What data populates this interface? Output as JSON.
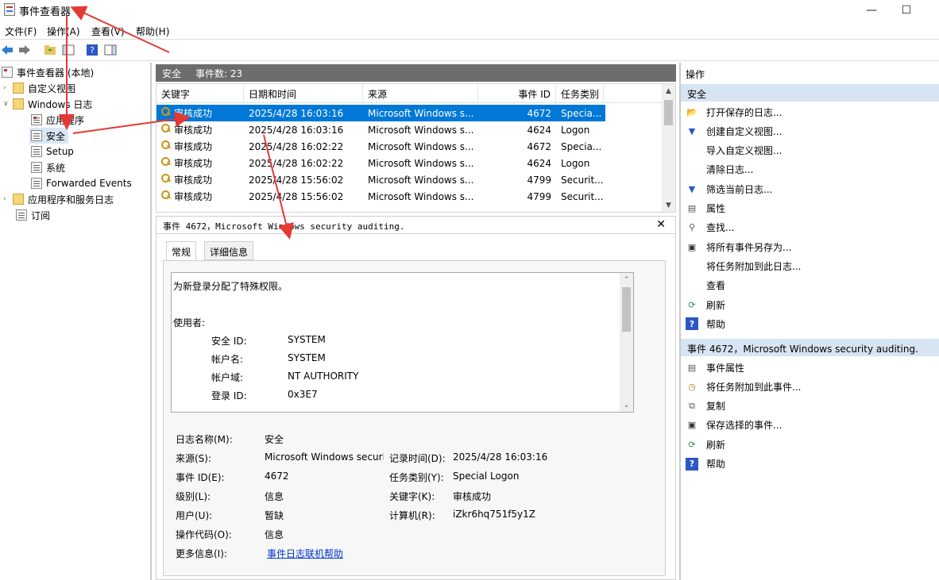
{
  "window": {
    "title": "事件查看器"
  },
  "menu": [
    "文件(F)",
    "操作(A)",
    "查看(V)",
    "帮助(H)"
  ],
  "tree": [
    {
      "label": "事件查看器 (本地)",
      "twisty": "",
      "icon": "app",
      "indent": 0
    },
    {
      "label": "自定义视图",
      "twisty": "›",
      "icon": "folder",
      "indent": 1
    },
    {
      "label": "Windows 日志",
      "twisty": "∨",
      "icon": "folder",
      "indent": 1
    },
    {
      "label": "应用程序",
      "twisty": "",
      "icon": "log",
      "indent": 2
    },
    {
      "label": "安全",
      "twisty": "",
      "icon": "log",
      "indent": 2,
      "selected": true
    },
    {
      "label": "Setup",
      "twisty": "",
      "icon": "log",
      "indent": 2
    },
    {
      "label": "系统",
      "twisty": "",
      "icon": "log",
      "indent": 2
    },
    {
      "label": "Forwarded Events",
      "twisty": "",
      "icon": "log",
      "indent": 2
    },
    {
      "label": "应用程序和服务日志",
      "twisty": "›",
      "icon": "folder",
      "indent": 1
    },
    {
      "label": "订阅",
      "twisty": "",
      "icon": "log",
      "indent": 1
    }
  ],
  "center_header": {
    "log": "安全",
    "count": "事件数: 23"
  },
  "grid": {
    "columns": [
      "关键字",
      "日期和时间",
      "来源",
      "事件 ID",
      "任务类别"
    ],
    "rows": [
      [
        "审核成功",
        "2025/4/28 16:03:16",
        "Microsoft Windows s...",
        "4672",
        "Specia..."
      ],
      [
        "审核成功",
        "2025/4/28 16:03:16",
        "Microsoft Windows s...",
        "4624",
        "Logon"
      ],
      [
        "审核成功",
        "2025/4/28 16:02:22",
        "Microsoft Windows s...",
        "4672",
        "Specia..."
      ],
      [
        "审核成功",
        "2025/4/28 16:02:22",
        "Microsoft Windows s...",
        "4624",
        "Logon"
      ],
      [
        "审核成功",
        "2025/4/28 15:56:02",
        "Microsoft Windows s...",
        "4799",
        "Securit..."
      ],
      [
        "审核成功",
        "2025/4/28 15:56:02",
        "Microsoft Windows s...",
        "4799",
        "Securit..."
      ]
    ]
  },
  "detail": {
    "title": "事件 4672，Microsoft Windows security auditing.",
    "tabs": [
      "常规",
      "详细信息"
    ],
    "message": {
      "line1": "为新登录分配了特殊权限。",
      "user_heading": "使用者:",
      "fields": [
        {
          "label": "安全 ID:",
          "value": "SYSTEM"
        },
        {
          "label": "帐户名:",
          "value": "SYSTEM"
        },
        {
          "label": "帐户域:",
          "value": "NT AUTHORITY"
        },
        {
          "label": "登录 ID:",
          "value": "0x3E7"
        }
      ]
    },
    "props": {
      "log_name_label": "日志名称(M):",
      "log_name": "安全",
      "source_label": "来源(S):",
      "source": "Microsoft Windows securi",
      "logged_label": "记录时间(D):",
      "logged": "2025/4/28 16:03:16",
      "event_id_label": "事件 ID(E):",
      "event_id": "4672",
      "task_label": "任务类别(Y):",
      "task": "Special Logon",
      "level_label": "级别(L):",
      "level": "信息",
      "keywords_label": "关键字(K):",
      "keywords": "审核成功",
      "user_label": "用户(U):",
      "user": "暂缺",
      "computer_label": "计算机(R):",
      "computer": "iZkr6hq751f5y1Z",
      "opcode_label": "操作代码(O):",
      "opcode": "信息",
      "more_label": "更多信息(I):",
      "more_link": "事件日志联机帮助"
    }
  },
  "actions": {
    "header": "操作",
    "section1": "安全",
    "items1": [
      {
        "label": "打开保存的日志...",
        "icon": "open-folder-icon"
      },
      {
        "label": "创建自定义视图...",
        "icon": "filter-icon"
      },
      {
        "label": "导入自定义视图...",
        "icon": ""
      },
      {
        "label": "清除日志...",
        "icon": ""
      },
      {
        "label": "筛选当前日志...",
        "icon": "filter-icon"
      },
      {
        "label": "属性",
        "icon": "properties-icon"
      },
      {
        "label": "查找...",
        "icon": "find-icon"
      },
      {
        "label": "将所有事件另存为...",
        "icon": "save-icon"
      },
      {
        "label": "将任务附加到此日志...",
        "icon": ""
      },
      {
        "label": "查看",
        "icon": ""
      },
      {
        "label": "刷新",
        "icon": "refresh-icon"
      },
      {
        "label": "帮助",
        "icon": "help-icon"
      }
    ],
    "section2": "事件 4672，Microsoft Windows security auditing.",
    "items2": [
      {
        "label": "事件属性",
        "icon": "properties-icon"
      },
      {
        "label": "将任务附加到此事件...",
        "icon": "task-icon"
      },
      {
        "label": "复制",
        "icon": "copy-icon"
      },
      {
        "label": "保存选择的事件...",
        "icon": "save-icon"
      },
      {
        "label": "刷新",
        "icon": "refresh-icon"
      },
      {
        "label": "帮助",
        "icon": "help-icon"
      }
    ]
  },
  "colors": {
    "selection": "#0078d7",
    "annotation": "#e53935",
    "section_bg": "#d7e4f2"
  }
}
